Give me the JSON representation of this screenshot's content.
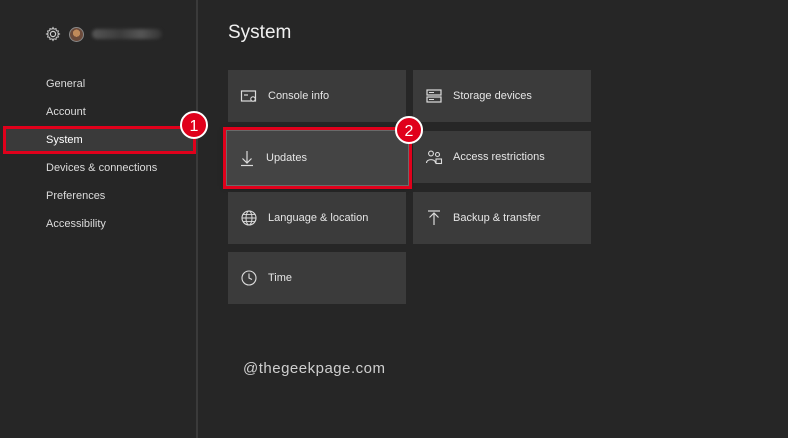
{
  "sidebar": {
    "items": [
      {
        "label": "General"
      },
      {
        "label": "Account"
      },
      {
        "label": "System"
      },
      {
        "label": "Devices & connections"
      },
      {
        "label": "Preferences"
      },
      {
        "label": "Accessibility"
      }
    ],
    "selected": "System"
  },
  "main": {
    "title": "System",
    "tiles": [
      {
        "label": "Console info",
        "icon": "console-info-icon"
      },
      {
        "label": "Storage devices",
        "icon": "storage-icon"
      },
      {
        "label": "Updates",
        "icon": "download-arrow-icon"
      },
      {
        "label": "Access restrictions",
        "icon": "people-lock-icon"
      },
      {
        "label": "Language & location",
        "icon": "globe-icon"
      },
      {
        "label": "Backup & transfer",
        "icon": "upload-arrow-icon"
      },
      {
        "label": "Time",
        "icon": "clock-icon"
      }
    ]
  },
  "annotations": {
    "step1": "1",
    "step2": "2",
    "highlight_color": "#e0001b"
  },
  "watermark": "@thegeekpage.com"
}
